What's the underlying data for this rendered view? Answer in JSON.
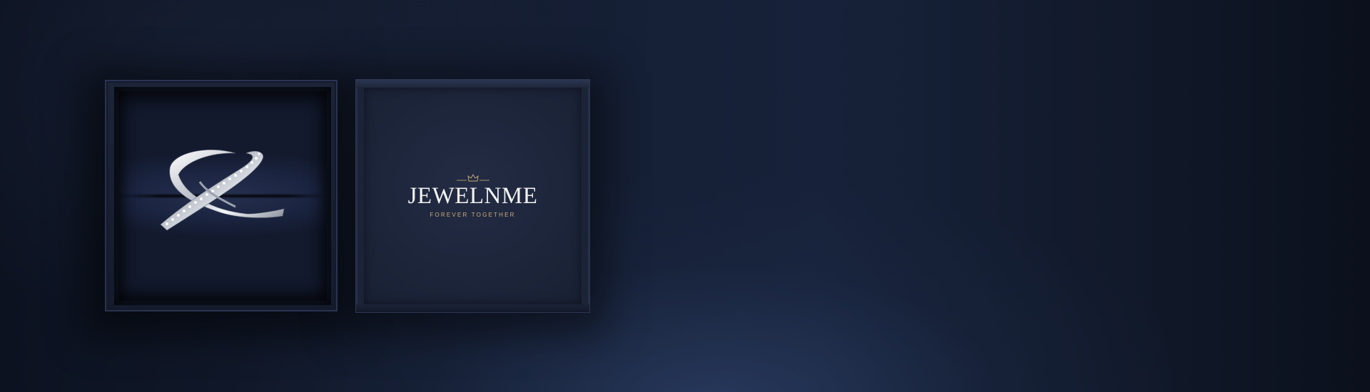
{
  "brand": {
    "name": "JEWELNME",
    "tagline": "FOREVER TOGETHER"
  },
  "icons": {
    "crown": "crown-icon",
    "ring": "ring-icon"
  },
  "colors": {
    "background": "#141d31",
    "box": "#1b2437",
    "tagline": "#cfae7a",
    "brand_text": "#f2f2f2"
  }
}
